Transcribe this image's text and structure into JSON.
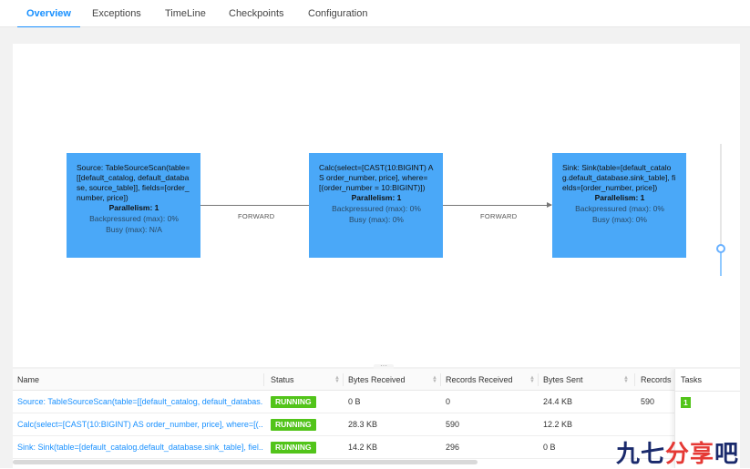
{
  "tabs": [
    {
      "label": "Overview",
      "active": true
    },
    {
      "label": "Exceptions",
      "active": false
    },
    {
      "label": "TimeLine",
      "active": false
    },
    {
      "label": "Checkpoints",
      "active": false
    },
    {
      "label": "Configuration",
      "active": false
    }
  ],
  "graph": {
    "nodes": [
      {
        "title": "Source: TableSourceScan(table=[[default_catalog, default_database, source_table]], fields=[order_number, price])",
        "parallelism": "Parallelism: 1",
        "backpressure": "Backpressured (max): 0%",
        "busy": "Busy (max): N/A"
      },
      {
        "title": "Calc(select=[CAST(10:BIGINT) AS order_number, price], where=[(order_number = 10:BIGINT)])",
        "parallelism": "Parallelism: 1",
        "backpressure": "Backpressured (max): 0%",
        "busy": "Busy (max): 0%"
      },
      {
        "title": "Sink: Sink(table=[default_catalog.default_database.sink_table], fields=[order_number, price])",
        "parallelism": "Parallelism: 1",
        "backpressure": "Backpressured (max): 0%",
        "busy": "Busy (max): 0%"
      }
    ],
    "edges": [
      {
        "label": "FORWARD"
      },
      {
        "label": "FORWARD"
      }
    ],
    "colors": {
      "node": "#4aa8f8",
      "accent": "#1890ff",
      "running": "#52c41a"
    }
  },
  "table": {
    "headers": {
      "name": "Name",
      "status": "Status",
      "bytes_received": "Bytes Received",
      "records_received": "Records Received",
      "bytes_sent": "Bytes Sent",
      "records_sent": "Records S",
      "tasks": "Tasks"
    },
    "rows": [
      {
        "name": "Source: TableSourceScan(table=[[default_catalog, default_databas...",
        "status": "RUNNING",
        "bytes_received": "0 B",
        "records_received": "0",
        "bytes_sent": "24.4 KB",
        "records_sent": "590",
        "tasks": "1"
      },
      {
        "name": "Calc(select=[CAST(10:BIGINT) AS order_number, price], where=[(...",
        "status": "RUNNING",
        "bytes_received": "28.3 KB",
        "records_received": "590",
        "bytes_sent": "12.2 KB",
        "records_sent": "",
        "tasks": ""
      },
      {
        "name": "Sink: Sink(table=[default_catalog.default_database.sink_table], fiel...",
        "status": "RUNNING",
        "bytes_received": "14.2 KB",
        "records_received": "296",
        "bytes_sent": "0 B",
        "records_sent": "",
        "tasks": ""
      }
    ]
  },
  "watermark": {
    "text_a": "九七",
    "text_b": "分享",
    "text_c": "吧"
  }
}
